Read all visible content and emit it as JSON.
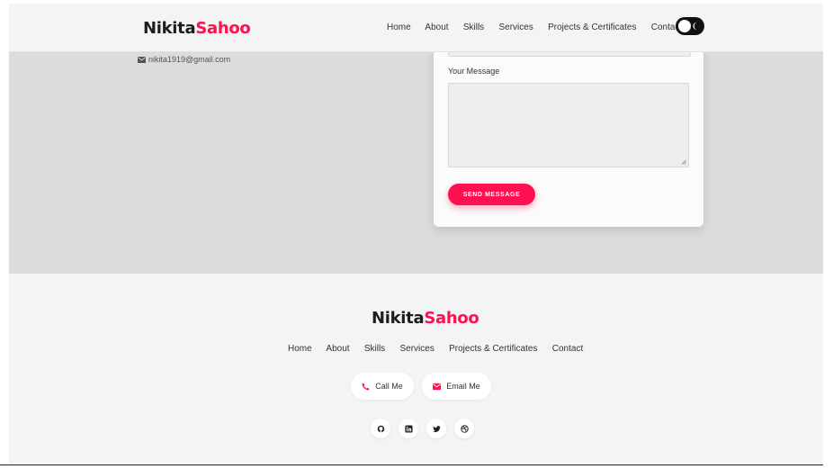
{
  "brand": {
    "first": "Nikita",
    "last": "Sahoo"
  },
  "header": {
    "nav": [
      "Home",
      "About",
      "Skills",
      "Services",
      "Projects & Certificates",
      "Contact"
    ],
    "theme_toggle_icon": "moon-icon"
  },
  "contact": {
    "email": "nikita1919@gmail.com",
    "email_icon": "envelope-icon",
    "message_label": "Your Message",
    "send_label": "SEND MESSAGE"
  },
  "footer": {
    "nav": [
      "Home",
      "About",
      "Skills",
      "Services",
      "Projects & Certificates",
      "Contact"
    ],
    "call_label": "Call Me",
    "email_label": "Email Me",
    "socials": [
      "github-icon",
      "linkedin-icon",
      "twitter-icon",
      "dribbble-icon"
    ]
  },
  "colors": {
    "accent": "#ff1050",
    "dark": "#1d1d1d",
    "header_bg": "#f4f4f4",
    "section_bg": "#dcdcdc"
  }
}
